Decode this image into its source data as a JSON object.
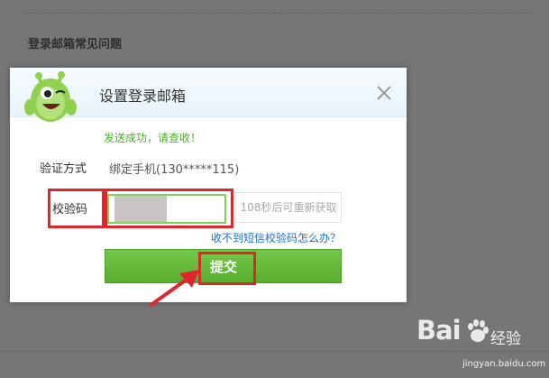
{
  "background": {
    "faq_title": "登录邮箱常见问题"
  },
  "dialog": {
    "title": "设置登录邮箱",
    "success_message": "发送成功，请查收！",
    "verify_method_label": "验证方式",
    "verify_method_value": "绑定手机(130*****115)",
    "code_label": "校验码",
    "code_value": "",
    "resend_text": "108秒后可重新获取",
    "help_link": "收不到短信校验码怎么办？",
    "submit_label": "提交"
  },
  "watermark": {
    "logo_text": "Bai",
    "logo_suffix": "经验",
    "url": "jingyan.baidu.com"
  },
  "colors": {
    "accent_green": "#58ad2f",
    "success_green": "#49b325",
    "highlight_red": "#e0262d",
    "link_blue": "#1e6fcf"
  }
}
